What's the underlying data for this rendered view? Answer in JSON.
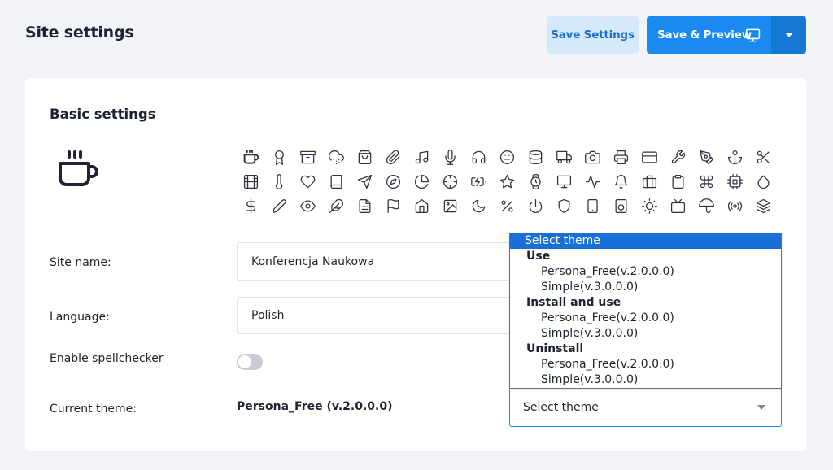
{
  "header": {
    "title": "Site settings",
    "save_label": "Save Settings",
    "preview_label": "Save & Preview"
  },
  "card": {
    "title": "Basic settings",
    "selected_icon": "coffee-icon",
    "icons": [
      "coffee",
      "award",
      "archive",
      "cloud-snow",
      "shopping-bag",
      "paperclip",
      "music",
      "mic",
      "headphones",
      "smile",
      "database",
      "truck",
      "camera",
      "printer",
      "credit-card",
      "tool",
      "pen-tool",
      "anchor",
      "scissors",
      "film",
      "thermometer",
      "heart",
      "book",
      "send",
      "compass",
      "pie-chart",
      "crosshair",
      "battery-charging",
      "star",
      "watch",
      "monitor",
      "activity",
      "bell",
      "briefcase",
      "clipboard",
      "command",
      "cpu",
      "droplet",
      "dollar-sign",
      "edit-2",
      "eye",
      "feather",
      "file-text",
      "flag",
      "home",
      "image",
      "moon",
      "percent",
      "power",
      "shield",
      "tablet",
      "speaker",
      "sun",
      "tv",
      "umbrella",
      "radio",
      "layers"
    ]
  },
  "form": {
    "site_name_label": "Site name:",
    "site_name_value": "Konferencja Naukowa",
    "language_label": "Language:",
    "language_value": "Polish",
    "spellcheck_label": "Enable spellchecker",
    "spellcheck_enabled": false,
    "theme_label": "Current theme:",
    "theme_value": "Persona_Free (v.2.0.0.0)",
    "theme_select_value": "Select theme"
  },
  "dropdown": {
    "selected": "Select theme",
    "groups": [
      {
        "label": "Use",
        "options": [
          "Persona_Free(v.2.0.0.0)",
          "Simple(v.3.0.0.0)"
        ]
      },
      {
        "label": "Install and use",
        "options": [
          "Persona_Free(v.2.0.0.0)",
          "Simple(v.3.0.0.0)"
        ]
      },
      {
        "label": "Uninstall",
        "options": [
          "Persona_Free(v.2.0.0.0)",
          "Simple(v.3.0.0.0)"
        ]
      }
    ]
  },
  "colors": {
    "primary": "#1a8af0",
    "primary_dark": "#1579d4",
    "primary_light": "#d6e9fb",
    "selected_option": "#1a6fd6",
    "background": "#f2f4f7"
  }
}
